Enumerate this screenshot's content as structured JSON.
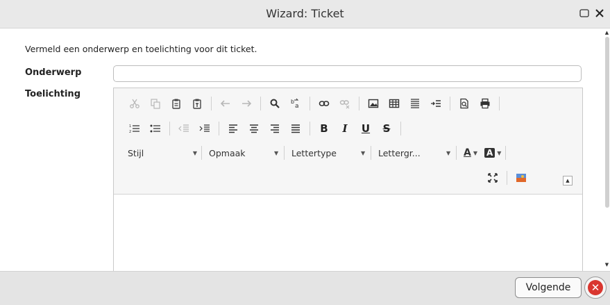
{
  "window": {
    "title": "Wizard: Ticket"
  },
  "form": {
    "intro": "Vermeld een onderwerp en toelichting voor dit ticket.",
    "subject_label": "Onderwerp",
    "subject_value": "",
    "description_label": "Toelichting"
  },
  "editor": {
    "combos": {
      "style": "Stijl",
      "format": "Opmaak",
      "font": "Lettertype",
      "size": "Lettergr..."
    },
    "bold": "B",
    "italic": "I",
    "underline": "U",
    "strike": "S",
    "text_color": "A",
    "bg_color": "A"
  },
  "footer": {
    "next_label": "Volgende"
  },
  "colors": {
    "close_red": "#d9362f"
  }
}
